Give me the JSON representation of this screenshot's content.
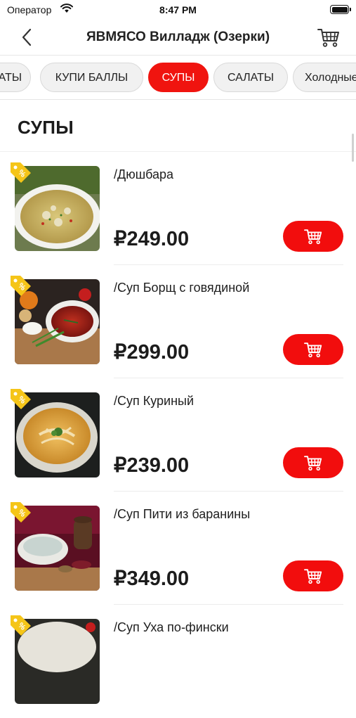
{
  "status_bar": {
    "carrier": "Оператор",
    "time": "8:47 PM"
  },
  "nav": {
    "title": "ЯВМЯСО Вилладж (Озерки)"
  },
  "categories": [
    {
      "label": "АТЫ"
    },
    {
      "label": "КУПИ БАЛЛЫ"
    },
    {
      "label": "СУПЫ",
      "active": true
    },
    {
      "label": "САЛАТЫ"
    },
    {
      "label": "Холодные"
    }
  ],
  "section": {
    "title": "СУПЫ"
  },
  "products": [
    {
      "name": "/Дюшбара",
      "price": "₽249.00",
      "image": "dushbara-soup"
    },
    {
      "name": "/Суп Борщ с говядиной",
      "price": "₽299.00",
      "image": "borscht-soup"
    },
    {
      "name": "/Суп Куриный",
      "price": "₽239.00",
      "image": "chicken-soup"
    },
    {
      "name": "/Суп Пити из баранины",
      "price": "₽349.00",
      "image": "piti-soup"
    },
    {
      "name": "/Суп Уха по-фински",
      "price": "",
      "image": "ukha-soup"
    }
  ],
  "colors": {
    "accent": "#f20d0d",
    "tag": "#f5c518",
    "text": "#1c1c1c"
  }
}
